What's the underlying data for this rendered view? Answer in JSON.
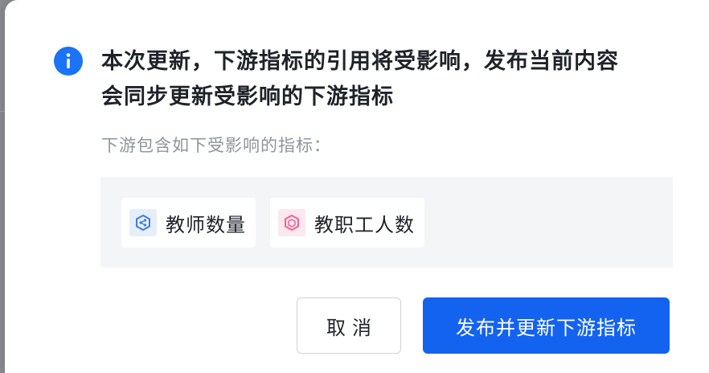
{
  "dialog": {
    "title_line1": "本次更新，下游指标的引用将受影响，发布当前内容",
    "title_line2": "会同步更新受影响的下游指标",
    "subtitle": "下游包含如下受影响的指标：",
    "affected_metrics": [
      {
        "label": "教师数量",
        "icon": "metric-derived-icon",
        "icon_color": "#3d7de0"
      },
      {
        "label": "教职工人数",
        "icon": "metric-hexagon-icon",
        "icon_color": "#f06290"
      }
    ],
    "cancel_label": "取消",
    "confirm_label": "发布并更新下游指标"
  },
  "colors": {
    "primary": "#1463f0",
    "info": "#1b73f5",
    "backdrop": "#8c8d91"
  }
}
